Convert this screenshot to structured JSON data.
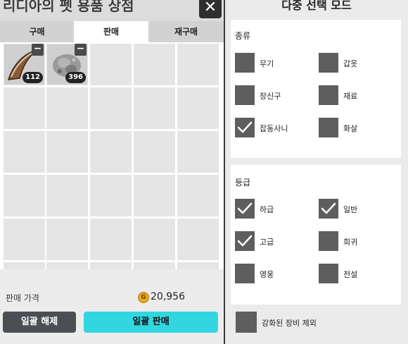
{
  "left": {
    "title": "리디아의 펫 용품 상점",
    "close_glyph": "✕",
    "tabs": [
      "구매",
      "판매",
      "재구매"
    ],
    "active_tab": 1,
    "items": [
      {
        "name": "claw-item",
        "quantity": "112"
      },
      {
        "name": "ash-item",
        "quantity": "396"
      }
    ],
    "price_label": "판매 가격",
    "coin_glyph": "G",
    "price_value": "20,956",
    "clear_button": "일괄 해제",
    "sell_button": "일괄 판매"
  },
  "right": {
    "title": "다중 선택 모드",
    "type_section": {
      "title": "종류",
      "options": [
        {
          "label": "무기",
          "checked": false
        },
        {
          "label": "갑옷",
          "checked": false
        },
        {
          "label": "장신구",
          "checked": false
        },
        {
          "label": "재료",
          "checked": false
        },
        {
          "label": "잡동사니",
          "checked": true
        },
        {
          "label": "화살",
          "checked": false
        }
      ]
    },
    "grade_section": {
      "title": "등급",
      "options": [
        {
          "label": "하급",
          "checked": true
        },
        {
          "label": "일반",
          "checked": true
        },
        {
          "label": "고급",
          "checked": true
        },
        {
          "label": "희귀",
          "checked": false
        },
        {
          "label": "영웅",
          "checked": false
        },
        {
          "label": "전설",
          "checked": false
        }
      ]
    },
    "exclude_enhanced": {
      "label": "강화된 장비 제외",
      "checked": false
    }
  }
}
